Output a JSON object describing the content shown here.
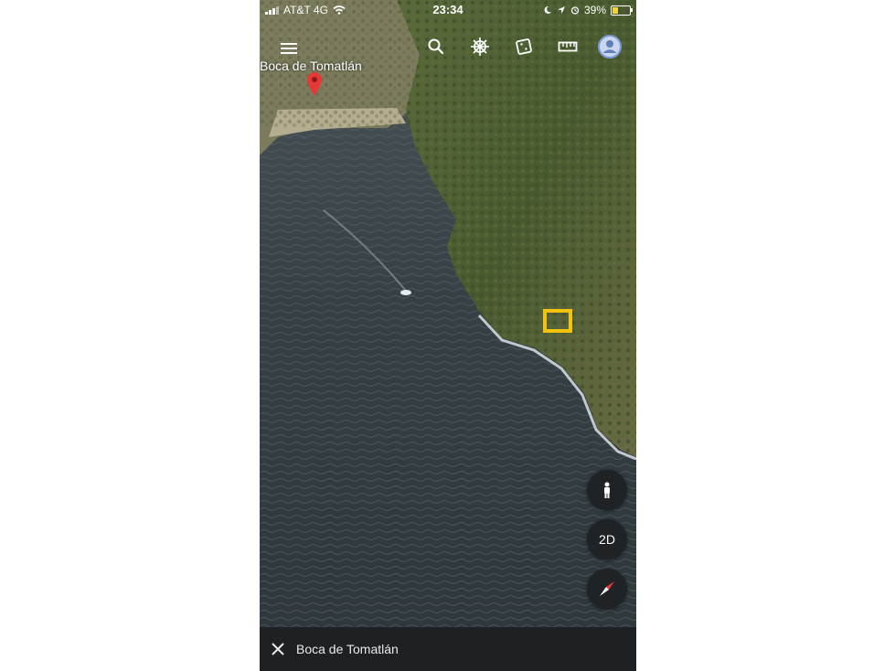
{
  "status_bar": {
    "carrier": "AT&T 4G",
    "time": "23:34",
    "battery": "39%",
    "battery_level": 0.39
  },
  "toolbar": {
    "menu_icon": "menu-icon",
    "search_icon": "search-icon",
    "voyager_icon": "helm-icon",
    "feeling_lucky_icon": "dice-icon",
    "measure_icon": "ruler-icon",
    "account_icon": "account-icon"
  },
  "map": {
    "place_label": "Boca de Tomatlán"
  },
  "controls": {
    "street_view_icon": "person-icon",
    "view_mode": "2D",
    "compass_icon": "compass-icon"
  },
  "bottom_bar": {
    "title": "Boca de Tomatlán",
    "close_icon": "close-icon"
  },
  "colors": {
    "highlight": "#f2c40f",
    "pin": "#e53935",
    "panel": "#1e2124"
  }
}
